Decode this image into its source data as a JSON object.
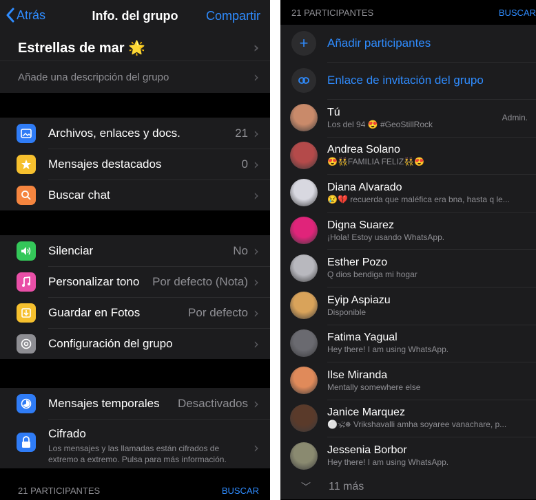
{
  "left": {
    "nav": {
      "back_label": "Atrás",
      "title": "Info. del grupo",
      "share_label": "Compartir"
    },
    "group": {
      "name": "Estrellas de mar 🌟",
      "description_placeholder": "Añade una descripción del grupo"
    },
    "section1": [
      {
        "label": "Archivos, enlaces y docs.",
        "value": "21",
        "icon": "photo-icon",
        "color": "#2f7cf6"
      },
      {
        "label": "Mensajes destacados",
        "value": "0",
        "icon": "star-icon",
        "color": "#f6c02e"
      },
      {
        "label": "Buscar chat",
        "value": "",
        "icon": "search-icon",
        "color": "#f5853f"
      }
    ],
    "section2": [
      {
        "label": "Silenciar",
        "value": "No",
        "icon": "speaker-icon",
        "color": "#34c759"
      },
      {
        "label": "Personalizar tono",
        "value": "Por defecto (Nota)",
        "icon": "music-note-icon",
        "color": "#e94fa7"
      },
      {
        "label": "Guardar en Fotos",
        "value": "Por defecto",
        "icon": "download-icon",
        "color": "#f6c02e"
      },
      {
        "label": "Configuración del grupo",
        "value": "",
        "icon": "gear-icon",
        "color": "#8e8e93"
      }
    ],
    "section3": {
      "temp": {
        "label": "Mensajes temporales",
        "value": "Desactivados",
        "icon": "timer-icon",
        "color": "#2f7cf6"
      },
      "encryption": {
        "label": "Cifrado",
        "sub": "Los mensajes y las llamadas están cifrados de extremo a extremo. Pulsa para más información.",
        "icon": "lock-icon",
        "color": "#2f7cf6"
      }
    },
    "footer": {
      "participants": "21 PARTICIPANTES",
      "search": "BUSCAR"
    }
  },
  "right": {
    "header": {
      "participants": "21 PARTICIPANTES",
      "search": "BUSCAR"
    },
    "actions": [
      {
        "label": "Añadir participantes",
        "icon": "plus-icon"
      },
      {
        "label": "Enlace de invitación del grupo",
        "icon": "link-icon"
      }
    ],
    "members": [
      {
        "name": "Tú",
        "status": "Los del 94 😍 #GeoStillRock",
        "badge": "Admin.",
        "avatar_color": "#c98a6a"
      },
      {
        "name": "Andrea Solano",
        "status": "😍👯FAMILIA FELIZ👯😍",
        "badge": "",
        "avatar_color": "#b44a4a"
      },
      {
        "name": "Diana Alvarado",
        "status": "😢💔 recuerda que maléfica era bna, hasta q le...",
        "badge": "",
        "avatar_color": "#d8d8e0"
      },
      {
        "name": "Digna Suarez",
        "status": "¡Hola! Estoy usando WhatsApp.",
        "badge": "",
        "avatar_color": "#e0247a"
      },
      {
        "name": "Esther Pozo",
        "status": "Q dios bendiga mi hogar",
        "badge": "",
        "avatar_color": "#b8b8be"
      },
      {
        "name": "Eyip Aspiazu",
        "status": "Disponible",
        "badge": "",
        "avatar_color": "#d9a35a"
      },
      {
        "name": "Fatima Yagual",
        "status": "Hey there! I am using WhatsApp.",
        "badge": "",
        "avatar_color": "#6a6a70"
      },
      {
        "name": "Ilse Miranda",
        "status": "Mentally somewhere else",
        "badge": "",
        "avatar_color": "#e08a5a"
      },
      {
        "name": "Janice Marquez",
        "status": "⚪🕉☸ Vrikshavalli amha soyaree vanachare, p...",
        "badge": "",
        "avatar_color": "#5a3a2a"
      },
      {
        "name": "Jessenia Borbor",
        "status": "Hey there! I am using WhatsApp.",
        "badge": "",
        "avatar_color": "#8a8a70"
      }
    ],
    "more_label": "11 más"
  }
}
